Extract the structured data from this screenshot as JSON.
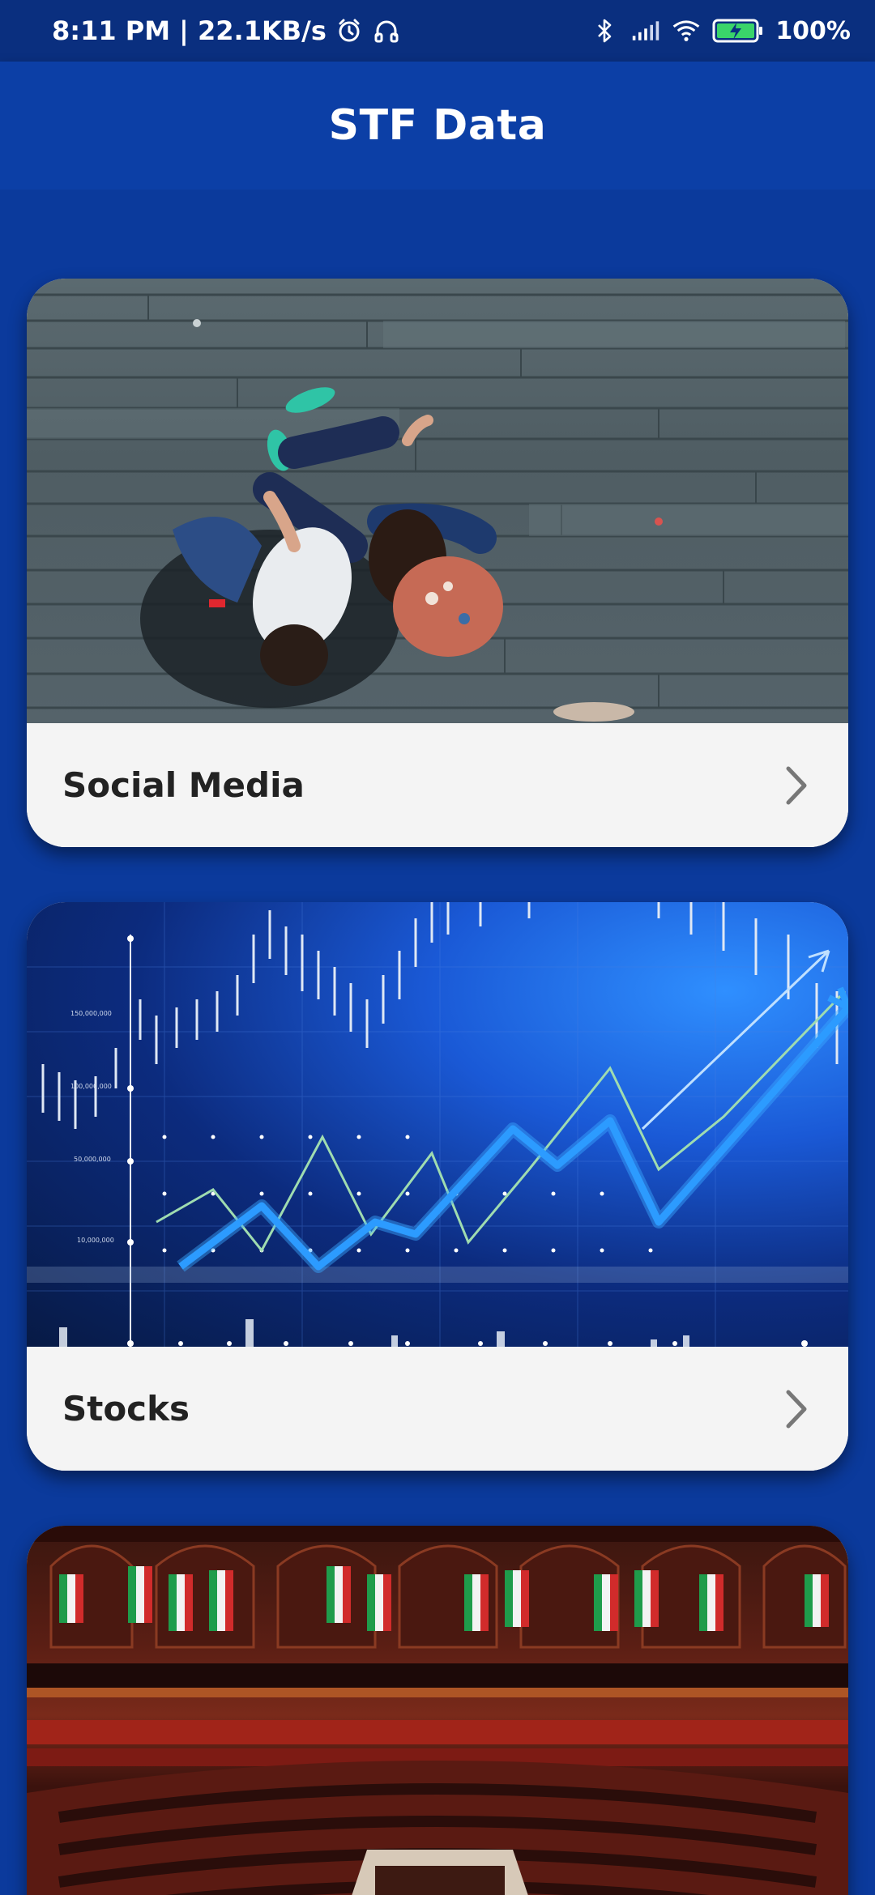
{
  "status_bar": {
    "time_speed": "8:11 PM | 22.1KB/s",
    "battery": "100%"
  },
  "app_bar": {
    "title": "STF Data"
  },
  "cards": [
    {
      "label": "Social Media",
      "image": "people-on-deck-photo"
    },
    {
      "label": "Stocks",
      "image": "stock-chart-photo"
    },
    {
      "label": "",
      "image": "parliament-photo"
    }
  ],
  "colors": {
    "background": "#0b3a9c",
    "app_bar": "#0c3fa6",
    "card_footer": "#f4f4f4",
    "label_text": "#222222"
  }
}
